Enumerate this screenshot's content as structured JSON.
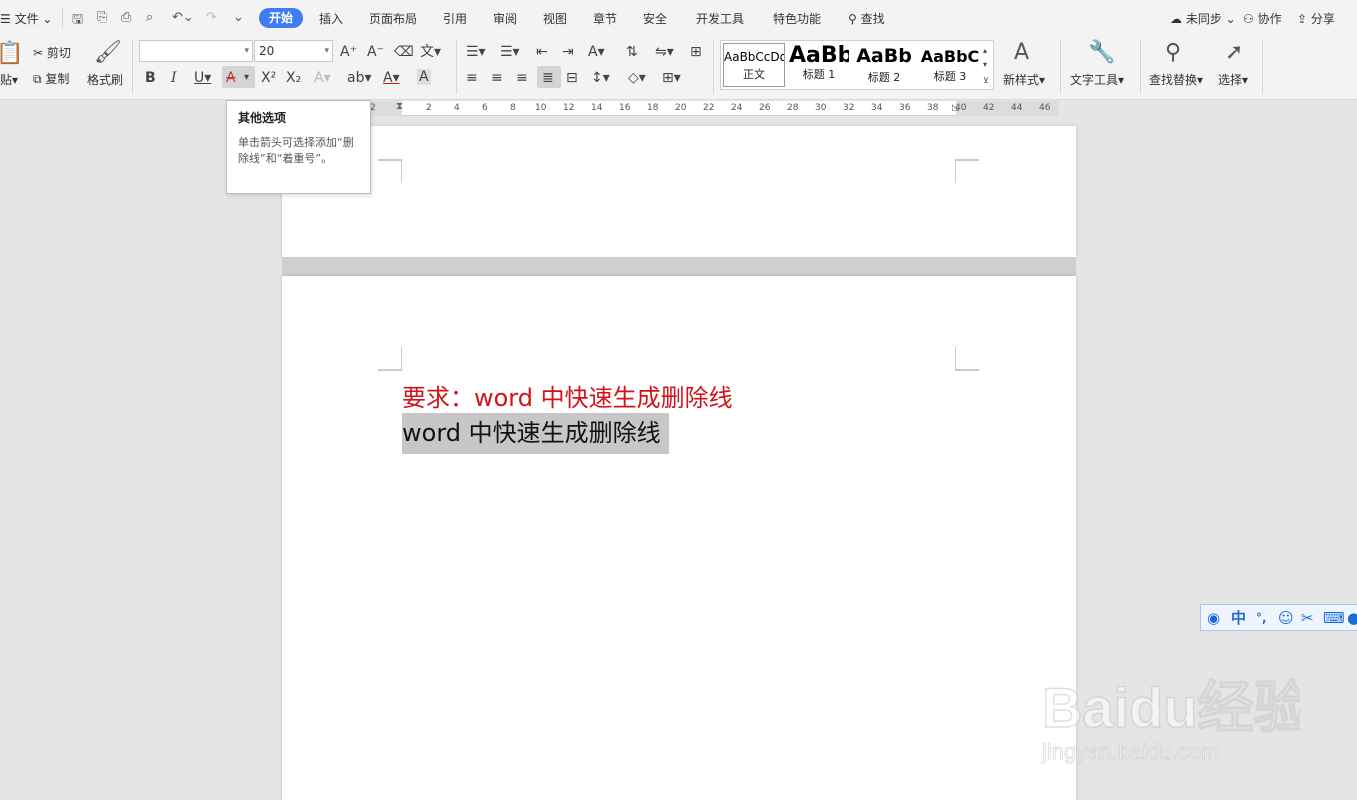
{
  "menu": {
    "file_label": "文件",
    "tabs": [
      "开始",
      "插入",
      "页面布局",
      "引用",
      "审阅",
      "视图",
      "章节",
      "安全",
      "开发工具",
      "特色功能"
    ],
    "search_label": "查找",
    "sync_label": "未同步",
    "collab_label": "协作",
    "share_label": "分享"
  },
  "ribbon": {
    "paste_label": "贴",
    "cut_label": "剪切",
    "copy_label": "复制",
    "format_painter_label": "格式刷",
    "font_name_value": "",
    "font_size_value": "20",
    "styles": [
      {
        "sample": "AaBbCcDd",
        "name": "正文"
      },
      {
        "sample": "AaBb",
        "name": "标题 1"
      },
      {
        "sample": "AaBb",
        "name": "标题 2"
      },
      {
        "sample": "AaBbC",
        "name": "标题 3"
      }
    ],
    "new_style_label": "新样式",
    "text_tools_label": "文字工具",
    "find_replace_label": "查找替换",
    "select_label": "选择"
  },
  "tooltip": {
    "title": "其他选项",
    "body": "单击箭头可选择添加“删除线”和“着重号”。"
  },
  "ruler": {
    "ticks": [
      "2",
      "2",
      "4",
      "6",
      "8",
      "10",
      "12",
      "14",
      "16",
      "18",
      "20",
      "22",
      "24",
      "26",
      "28",
      "30",
      "32",
      "34",
      "36",
      "38",
      "40",
      "42",
      "44",
      "46"
    ]
  },
  "document": {
    "requirement_line": "要求：word 中快速生成删除线",
    "selected_line": "word 中快速生成删除线"
  },
  "ime": {
    "mode_label": "中"
  },
  "watermark": {
    "brand": "Baidu经验",
    "url": "jingyan.baidu.com"
  },
  "colors": {
    "accent": "#3f7cf2",
    "requirement_text": "#d0141e",
    "selection": "#c7c7c7"
  }
}
